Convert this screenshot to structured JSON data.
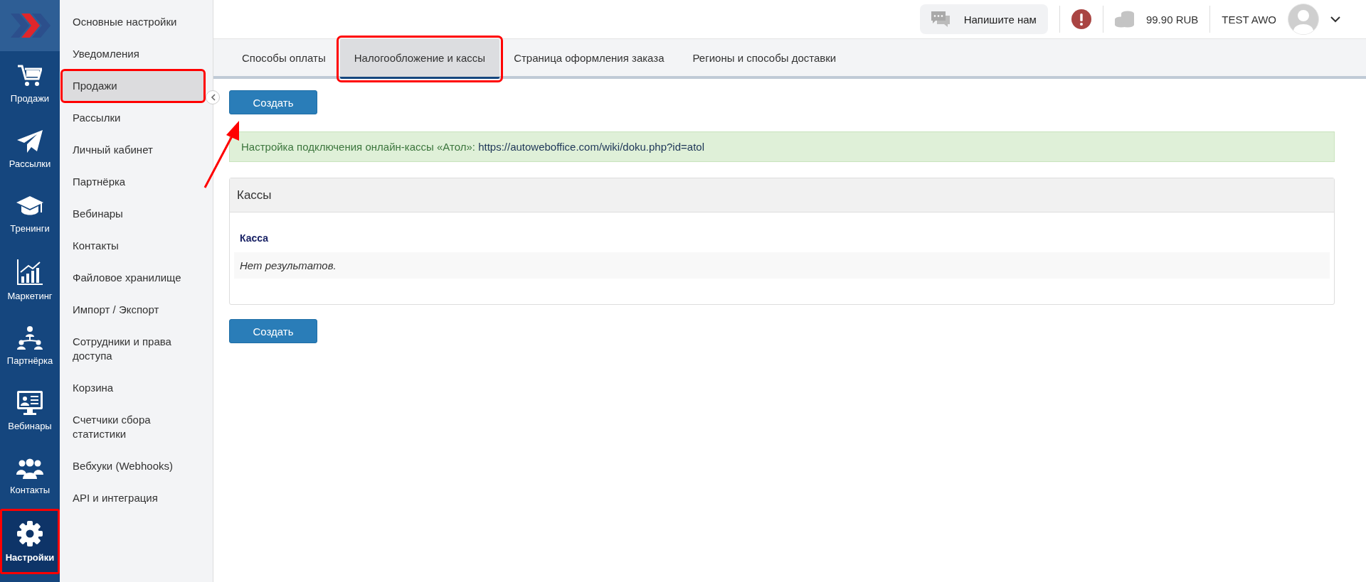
{
  "rail": [
    {
      "label": "Продажи",
      "selected": false,
      "highlighted": false
    },
    {
      "label": "Рассылки",
      "selected": false,
      "highlighted": false
    },
    {
      "label": "Тренинги",
      "selected": false,
      "highlighted": false
    },
    {
      "label": "Маркетинг",
      "selected": false,
      "highlighted": false
    },
    {
      "label": "Партнёрка",
      "selected": false,
      "highlighted": false
    },
    {
      "label": "Вебинары",
      "selected": false,
      "highlighted": false
    },
    {
      "label": "Контакты",
      "selected": false,
      "highlighted": false
    },
    {
      "label": "Настройки",
      "selected": true,
      "highlighted": true
    }
  ],
  "menu": [
    {
      "label": "Основные настройки",
      "selected": false,
      "highlighted": false
    },
    {
      "label": "Уведомления",
      "selected": false,
      "highlighted": false
    },
    {
      "label": "Продажи",
      "selected": true,
      "highlighted": true
    },
    {
      "label": "Рассылки",
      "selected": false,
      "highlighted": false
    },
    {
      "label": "Личный кабинет",
      "selected": false,
      "highlighted": false
    },
    {
      "label": "Партнёрка",
      "selected": false,
      "highlighted": false
    },
    {
      "label": "Вебинары",
      "selected": false,
      "highlighted": false
    },
    {
      "label": "Контакты",
      "selected": false,
      "highlighted": false
    },
    {
      "label": "Файловое хранилище",
      "selected": false,
      "highlighted": false
    },
    {
      "label": "Импорт / Экспорт",
      "selected": false,
      "highlighted": false
    },
    {
      "label": "Сотрудники и права доступа",
      "selected": false,
      "highlighted": false
    },
    {
      "label": "Корзина",
      "selected": false,
      "highlighted": false
    },
    {
      "label": "Счетчики сбора статистики",
      "selected": false,
      "highlighted": false
    },
    {
      "label": "Вебхуки (Webhooks)",
      "selected": false,
      "highlighted": false
    },
    {
      "label": "API и интеграция",
      "selected": false,
      "highlighted": false
    }
  ],
  "topbar": {
    "chat_button": "Напишите нам",
    "balance": "99.90 RUB",
    "user": "TEST AWO"
  },
  "tabs": [
    {
      "label": "Способы оплаты",
      "selected": false,
      "highlighted": false
    },
    {
      "label": "Налогообложение и кассы",
      "selected": true,
      "highlighted": true
    },
    {
      "label": "Страница оформления заказа",
      "selected": false,
      "highlighted": false
    },
    {
      "label": "Регионы и способы доставки",
      "selected": false,
      "highlighted": false
    }
  ],
  "create_button_top": "Создать",
  "notice": {
    "text": "Настройка подключения онлайн-кассы «Атол»:",
    "link": "https://autoweboffice.com/wiki/doku.php?id=atol"
  },
  "panel": {
    "title": "Кассы",
    "column": "Касса",
    "empty": "Нет результатов."
  },
  "create_button_bottom": "Создать"
}
